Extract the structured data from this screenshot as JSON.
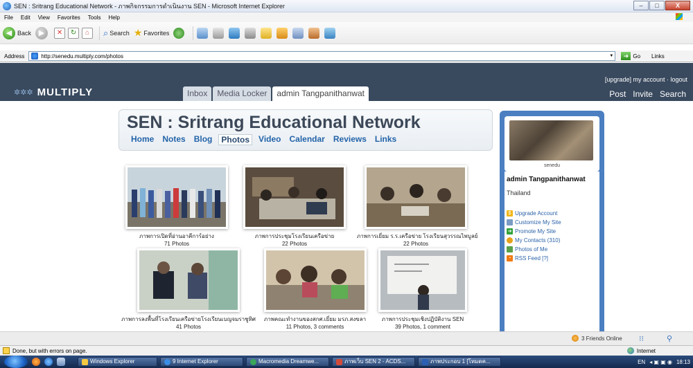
{
  "window": {
    "title": "SEN : Sritrang Educational Network - ภาพกิจกรรมการดำเนินงาน SEN - Microsoft Internet Explorer",
    "buttons": {
      "minimize": "–",
      "maximize": "□",
      "close": "X"
    }
  },
  "menu": [
    "File",
    "Edit",
    "View",
    "Favorites",
    "Tools",
    "Help"
  ],
  "toolbar": {
    "back_label": "Back",
    "search_label": "Search",
    "favorites_label": "Favorites"
  },
  "address": {
    "label": "Address",
    "url": "http://senedu.multiply.com/photos",
    "go_label": "Go",
    "links_label": "Links"
  },
  "site": {
    "logo": "MULTIPLY",
    "tabs": [
      "Inbox",
      "Media Locker",
      "admin Tangpanithanwat"
    ],
    "account_links": "[upgrade] my account · logout",
    "actions": [
      "Post",
      "Invite",
      "Search"
    ],
    "site_title": "SEN : Sritrang Educational Network",
    "subnav": [
      "Home",
      "Notes",
      "Blog",
      "Photos",
      "Video",
      "Calendar",
      "Reviews",
      "Links"
    ],
    "subnav_current": "Photos"
  },
  "albums": [
    {
      "title": "ภาพการเปิดที่อ่านอาคีการ์อย่าง",
      "count": "71 Photos"
    },
    {
      "title": "ภาพการประชุมโรงเรียนเครือข่าย",
      "count": "22 Photos"
    },
    {
      "title": "ภาพการเยี่ยม ร.ร.เครือข่าย โรงเรียนสุวรรณไพบูลย์",
      "count": "22 Photos"
    },
    {
      "title": "ภาพการลงพื้นที่โรงเรียนเครือข่ายโรงเรียนเบญจมราชูทิศ",
      "count": "41 Photos"
    },
    {
      "title": "ภาพคณะทำงานของสกศ.เยี่ยม มรภ.สงขลา",
      "count": "11 Photos, 3 comments"
    },
    {
      "title": "ภาพการประชุมเชิงปฏิบัติงาน SEN",
      "count": "39 Photos, 1 comment"
    }
  ],
  "sidebar": {
    "avatar_name": "senedu",
    "profile_name": "admin Tangpanithanwat",
    "country": "Thailand",
    "links": [
      {
        "label": "Upgrade Account",
        "icon": "upgrade-icon",
        "color": "#f2b718"
      },
      {
        "label": "Customize My Site",
        "icon": "customize-icon",
        "color": "#7b9cc4"
      },
      {
        "label": "Promote My Site",
        "icon": "promote-icon",
        "color": "#33a33a"
      },
      {
        "label": "My Contacts (310)",
        "icon": "contacts-icon",
        "color": "#e6a21a"
      },
      {
        "label": "Photos of Me",
        "icon": "photos-icon",
        "color": "#5aa04a"
      },
      {
        "label": "RSS Feed [?]",
        "icon": "rss-icon",
        "color": "#f07a13"
      }
    ]
  },
  "friends_online": "3 Friends Online",
  "status": {
    "text": "Done, but with errors on page.",
    "zone": "Internet"
  },
  "taskbar": {
    "tasks": [
      "Windows Explorer",
      "9 Internet Explorer",
      "Macromedia Dreamwe...",
      "ภาพเว็บ SEN 2 - ACDS...",
      "ภาพประกอบ 1 [โหมดค..."
    ],
    "tray_lang": "EN",
    "clock": "18:13"
  },
  "colors": {
    "header_bg": "#39495e",
    "sidebar_bg": "#4b7fc1",
    "link": "#2363a8"
  }
}
